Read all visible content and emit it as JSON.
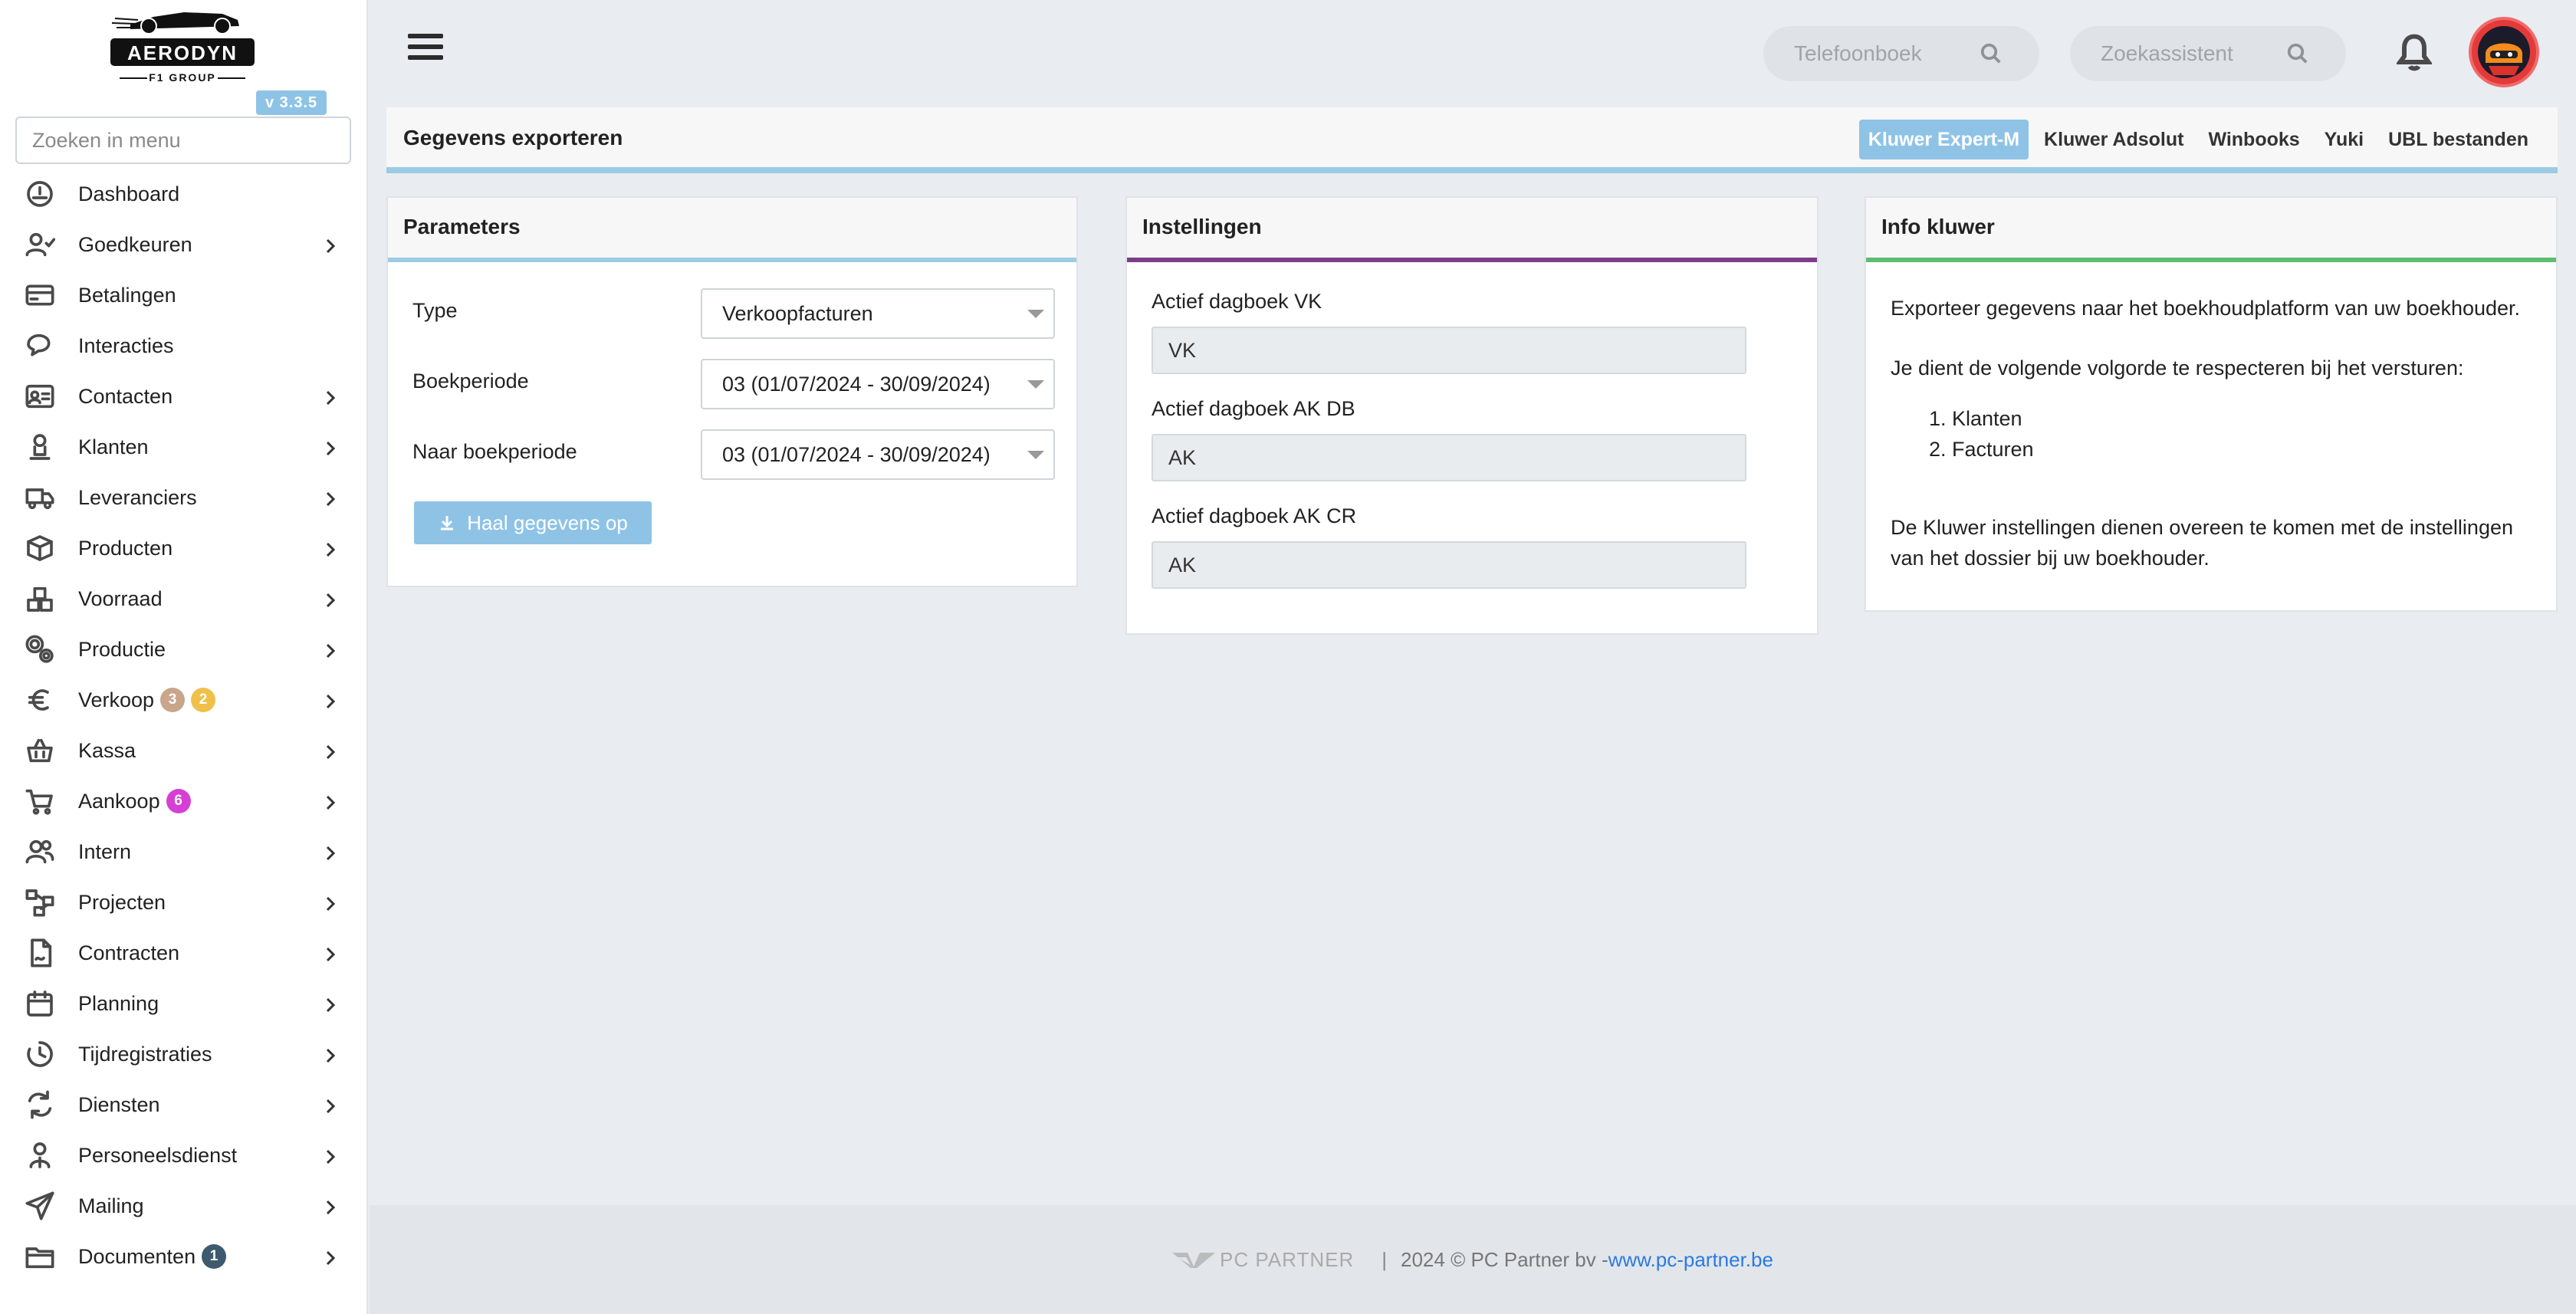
{
  "app": {
    "version": "v 3.3.5",
    "logo_text": "AERODYN",
    "logo_subtext": "F1 GROUP"
  },
  "sidebar": {
    "search_placeholder": "Zoeken in menu",
    "items": [
      {
        "label": "Dashboard",
        "icon": "dashboard-icon",
        "has_children": false
      },
      {
        "label": "Goedkeuren",
        "icon": "user-check-icon",
        "has_children": true
      },
      {
        "label": "Betalingen",
        "icon": "credit-card-icon",
        "has_children": false
      },
      {
        "label": "Interacties",
        "icon": "chat-icon",
        "has_children": false
      },
      {
        "label": "Contacten",
        "icon": "contact-card-icon",
        "has_children": true
      },
      {
        "label": "Klanten",
        "icon": "person-icon",
        "has_children": true
      },
      {
        "label": "Leveranciers",
        "icon": "truck-icon",
        "has_children": true
      },
      {
        "label": "Producten",
        "icon": "box-icon",
        "has_children": true
      },
      {
        "label": "Voorraad",
        "icon": "boxes-icon",
        "has_children": true
      },
      {
        "label": "Productie",
        "icon": "gears-icon",
        "has_children": true
      },
      {
        "label": "Verkoop",
        "icon": "euro-icon",
        "has_children": true,
        "badges": [
          {
            "value": "3",
            "color": "#c9a58a"
          },
          {
            "value": "2",
            "color": "#f0c04a"
          }
        ]
      },
      {
        "label": "Kassa",
        "icon": "basket-icon",
        "has_children": true
      },
      {
        "label": "Aankoop",
        "icon": "cart-icon",
        "has_children": true,
        "badges": [
          {
            "value": "6",
            "color": "#d63fd4"
          }
        ]
      },
      {
        "label": "Intern",
        "icon": "users-icon",
        "has_children": true
      },
      {
        "label": "Projecten",
        "icon": "project-icon",
        "has_children": true
      },
      {
        "label": "Contracten",
        "icon": "contract-icon",
        "has_children": true
      },
      {
        "label": "Planning",
        "icon": "calendar-icon",
        "has_children": true
      },
      {
        "label": "Tijdregistraties",
        "icon": "clock-icon",
        "has_children": true
      },
      {
        "label": "Diensten",
        "icon": "refresh-icon",
        "has_children": true
      },
      {
        "label": "Personeelsdienst",
        "icon": "staff-icon",
        "has_children": true
      },
      {
        "label": "Mailing",
        "icon": "paper-plane-icon",
        "has_children": true
      },
      {
        "label": "Documenten",
        "icon": "folder-icon",
        "has_children": true,
        "badges": [
          {
            "value": "1",
            "color": "#3d5a6e"
          }
        ]
      }
    ]
  },
  "topbar": {
    "phonebook_placeholder": "Telefoonboek",
    "assistant_placeholder": "Zoekassistent"
  },
  "page": {
    "title": "Gegevens exporteren",
    "tabs": [
      {
        "label": "Kluwer Expert-M",
        "active": true
      },
      {
        "label": "Kluwer Adsolut",
        "active": false
      },
      {
        "label": "Winbooks",
        "active": false
      },
      {
        "label": "Yuki",
        "active": false
      },
      {
        "label": "UBL bestanden",
        "active": false
      }
    ]
  },
  "parameters": {
    "title": "Parameters",
    "type_label": "Type",
    "type_value": "Verkoopfacturen",
    "period_label": "Boekperiode",
    "period_value": "03 (01/07/2024 - 30/09/2024)",
    "to_period_label": "Naar boekperiode",
    "to_period_value": "03 (01/07/2024 - 30/09/2024)",
    "fetch_button": "Haal gegevens op"
  },
  "settings": {
    "title": "Instellingen",
    "vk_label": "Actief dagboek VK",
    "vk_value": "VK",
    "akdb_label": "Actief dagboek AK DB",
    "akdb_value": "AK",
    "akcr_label": "Actief dagboek AK CR",
    "akcr_value": "AK"
  },
  "info": {
    "title": "Info kluwer",
    "line1": "Exporteer gegevens naar het boekhoudplatform van uw boekhouder.",
    "line2": "Je dient de volgende volgorde te respecteren bij het versturen:",
    "steps": [
      "Klanten",
      "Facturen"
    ],
    "line3": "De Kluwer instellingen dienen overeen te komen met de instellingen van het dossier bij uw boekhouder."
  },
  "footer": {
    "brand": "PC PARTNER",
    "separator": "|",
    "copyright": "2024 © PC Partner bv - ",
    "link": "www.pc-partner.be"
  },
  "colors": {
    "accent_blue": "#8ec3e6",
    "settings_purple": "#7c3e8a",
    "info_green": "#5dbd71"
  }
}
